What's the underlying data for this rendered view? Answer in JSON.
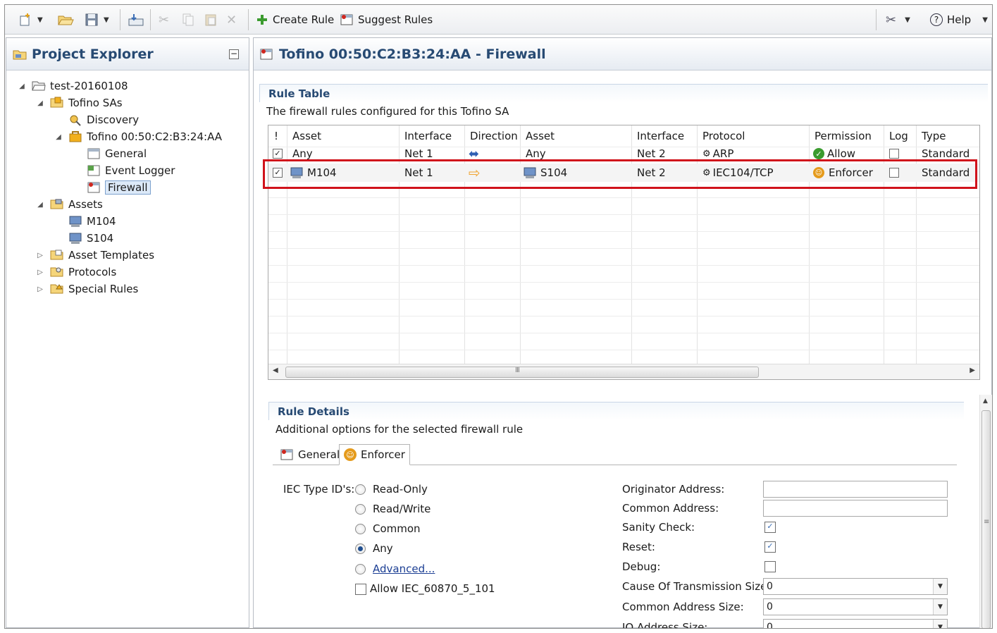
{
  "toolbar": {
    "create_rule": "Create Rule",
    "suggest_rules": "Suggest Rules",
    "help": "Help"
  },
  "explorer": {
    "title": "Project Explorer",
    "tree": [
      {
        "label": "test-20160108",
        "icon": "folder-open-icon",
        "expanded": true
      },
      {
        "label": "Tofino SAs",
        "icon": "tofino-folder-icon",
        "expanded": true
      },
      {
        "label": "Discovery",
        "icon": "discovery-icon"
      },
      {
        "label": "Tofino 00:50:C2:B3:24:AA",
        "icon": "tofino-device-icon",
        "expanded": true
      },
      {
        "label": "General",
        "icon": "general-icon"
      },
      {
        "label": "Event Logger",
        "icon": "event-logger-icon"
      },
      {
        "label": "Firewall",
        "icon": "firewall-icon",
        "selected": true
      },
      {
        "label": "Assets",
        "icon": "assets-folder-icon",
        "expanded": true
      },
      {
        "label": "M104",
        "icon": "computer-icon"
      },
      {
        "label": "S104",
        "icon": "computer-icon"
      },
      {
        "label": "Asset Templates",
        "icon": "templates-folder-icon",
        "expanded": false
      },
      {
        "label": "Protocols",
        "icon": "protocols-folder-icon",
        "expanded": false
      },
      {
        "label": "Special Rules",
        "icon": "special-rules-folder-icon",
        "expanded": false
      }
    ]
  },
  "editor": {
    "title": "Tofino 00:50:C2:B3:24:AA - Firewall"
  },
  "rule_table": {
    "heading": "Rule Table",
    "description": "The firewall rules configured for this Tofino SA",
    "columns": [
      "!",
      "Asset",
      "Interface",
      "Direction",
      "Asset",
      "Interface",
      "Protocol",
      "Permission",
      "Log",
      "Type"
    ],
    "rows": [
      {
        "enabled": true,
        "asset_src": "Any",
        "iface_src": "Net 1",
        "direction": "bidirectional",
        "asset_dst": "Any",
        "iface_dst": "Net 2",
        "protocol": "ARP",
        "permission": "Allow",
        "log": false,
        "type": "Standard"
      },
      {
        "enabled": true,
        "asset_src": "M104",
        "iface_src": "Net 1",
        "direction": "forward",
        "asset_dst": "S104",
        "iface_dst": "Net 2",
        "protocol": "IEC104/TCP",
        "permission": "Enforcer",
        "log": false,
        "type": "Standard"
      }
    ],
    "scroll_marker": "III"
  },
  "rule_details": {
    "heading": "Rule Details",
    "description": "Additional options for the selected firewall rule",
    "tabs": [
      {
        "label": "General",
        "active": false
      },
      {
        "label": "Enforcer",
        "active": true
      }
    ],
    "iec_type_label": "IEC Type ID's:",
    "iec_options": [
      {
        "label": "Read-Only",
        "selected": false
      },
      {
        "label": "Read/Write",
        "selected": false
      },
      {
        "label": "Common",
        "selected": false
      },
      {
        "label": "Any",
        "selected": true
      },
      {
        "label": "Advanced...",
        "selected": false,
        "link": true
      }
    ],
    "allow_101_label": "Allow IEC_60870_5_101",
    "allow_101_checked": false,
    "fields": {
      "originator_address": {
        "label": "Originator Address:",
        "value": ""
      },
      "common_address": {
        "label": "Common Address:",
        "value": ""
      },
      "sanity_check": {
        "label": "Sanity Check:",
        "checked": true
      },
      "reset": {
        "label": "Reset:",
        "checked": true
      },
      "debug": {
        "label": "Debug:",
        "checked": false
      },
      "cot_size": {
        "label": "Cause Of Transmission Size:",
        "value": "0"
      },
      "common_address_size": {
        "label": "Common Address Size:",
        "value": "0"
      },
      "io_address_size": {
        "label": "IO Address Size:",
        "value": "0"
      }
    }
  },
  "colors": {
    "header_text": "#274a73",
    "highlight_border": "#d0121b",
    "allow_green": "#3a9b2e",
    "enforcer_orange": "#e59b1c",
    "direction_blue": "#2f5fb3",
    "direction_orange": "#f0a431"
  }
}
